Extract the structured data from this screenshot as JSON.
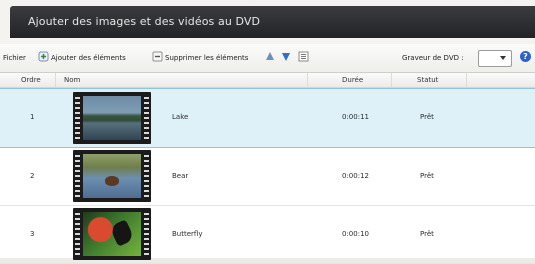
{
  "window": {
    "title": "Ajouter des images et des vidéos au DVD"
  },
  "toolbar": {
    "fichier": "Fichier",
    "add": "Ajouter des éléments",
    "remove": "Supprimer les éléments",
    "burner_label": "Graveur de DVD :",
    "burner_value": "",
    "help": "?"
  },
  "table": {
    "headers": {
      "ordre": "Ordre",
      "nom": "Nom",
      "duree": "Durée",
      "statut": "Statut"
    },
    "rows": [
      {
        "ordre": "1",
        "nom": "Lake",
        "duree": "0:00:11",
        "statut": "Prêt",
        "selected": true
      },
      {
        "ordre": "2",
        "nom": "Bear",
        "duree": "0:00:12",
        "statut": "Prêt",
        "selected": false
      },
      {
        "ordre": "3",
        "nom": "Butterfly",
        "duree": "0:00:10",
        "statut": "Prêt",
        "selected": false
      }
    ]
  },
  "colors": {
    "titlebar": "#2c2d30",
    "selection": "#dff1f8",
    "accent": "#2f6fd1"
  }
}
